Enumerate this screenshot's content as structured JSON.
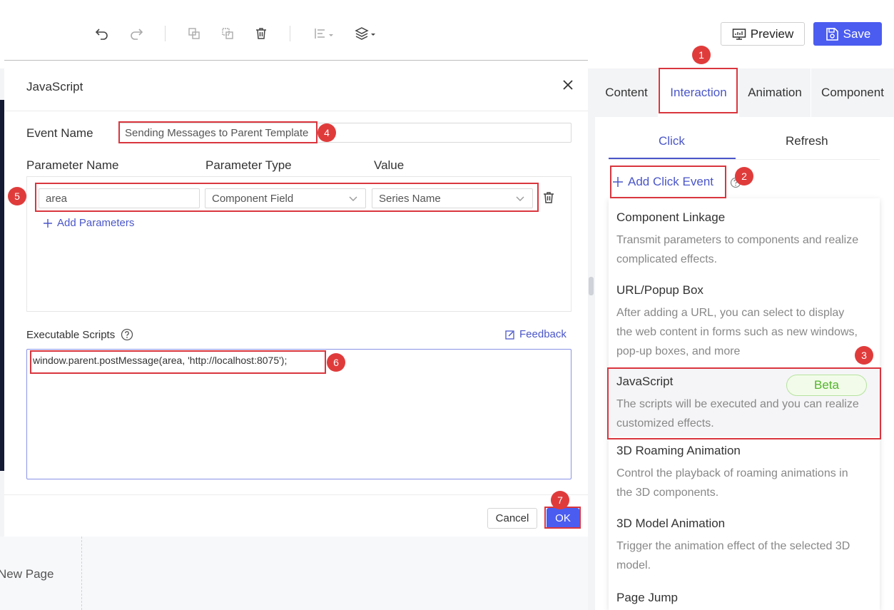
{
  "toolbar": {
    "icons": [
      "undo-icon",
      "redo-icon",
      "copy-icon",
      "paste-icon",
      "delete-icon",
      "align-icon",
      "layers-icon"
    ],
    "preview_label": "Preview",
    "save_label": "Save"
  },
  "canvas": {
    "page_label": "New Page"
  },
  "modal": {
    "title": "JavaScript",
    "event_name_label": "Event Name",
    "event_name_value": "Sending Messages to Parent Template",
    "columns": {
      "param_name": "Parameter Name",
      "param_type": "Parameter Type",
      "value": "Value"
    },
    "param_row": {
      "name": "area",
      "type": "Component Field",
      "value": "Series Name"
    },
    "add_params_label": "Add Parameters",
    "exec_scripts_label": "Executable Scripts",
    "feedback_label": "Feedback",
    "script": "window.parent.postMessage(area, 'http://localhost:8075');",
    "cancel_label": "Cancel",
    "ok_label": "OK"
  },
  "right_panel": {
    "tabs": [
      {
        "label": "Content"
      },
      {
        "label": "Interaction"
      },
      {
        "label": "Animation"
      },
      {
        "label": "Component"
      }
    ],
    "active_tab": "Interaction",
    "subtabs": [
      {
        "label": "Click"
      },
      {
        "label": "Refresh"
      }
    ],
    "add_click_label": "Add Click Event",
    "events": [
      {
        "title": "Component Linkage",
        "desc": "Transmit parameters to components and realize complicated effects."
      },
      {
        "title": "URL/Popup Box",
        "desc": "After adding a URL, you can select to display the web content in forms such as new windows, pop-up boxes, and more"
      },
      {
        "title": "JavaScript",
        "badge": "Beta",
        "desc": "The scripts will be executed and you can realize customized effects."
      },
      {
        "title": "3D Roaming Animation",
        "desc": "Control the playback of roaming animations in the 3D components."
      },
      {
        "title": "3D Model Animation",
        "desc": "Trigger the animation effect of the selected 3D model."
      },
      {
        "title": "Page Jump",
        "desc": ""
      }
    ]
  },
  "annotations": {
    "markers": [
      "1",
      "2",
      "3",
      "4",
      "5",
      "6",
      "7"
    ],
    "color": "#d9363e"
  },
  "colors": {
    "accent": "#4b5cf0",
    "link": "#4a56c8",
    "badge_text": "#52b52b"
  }
}
